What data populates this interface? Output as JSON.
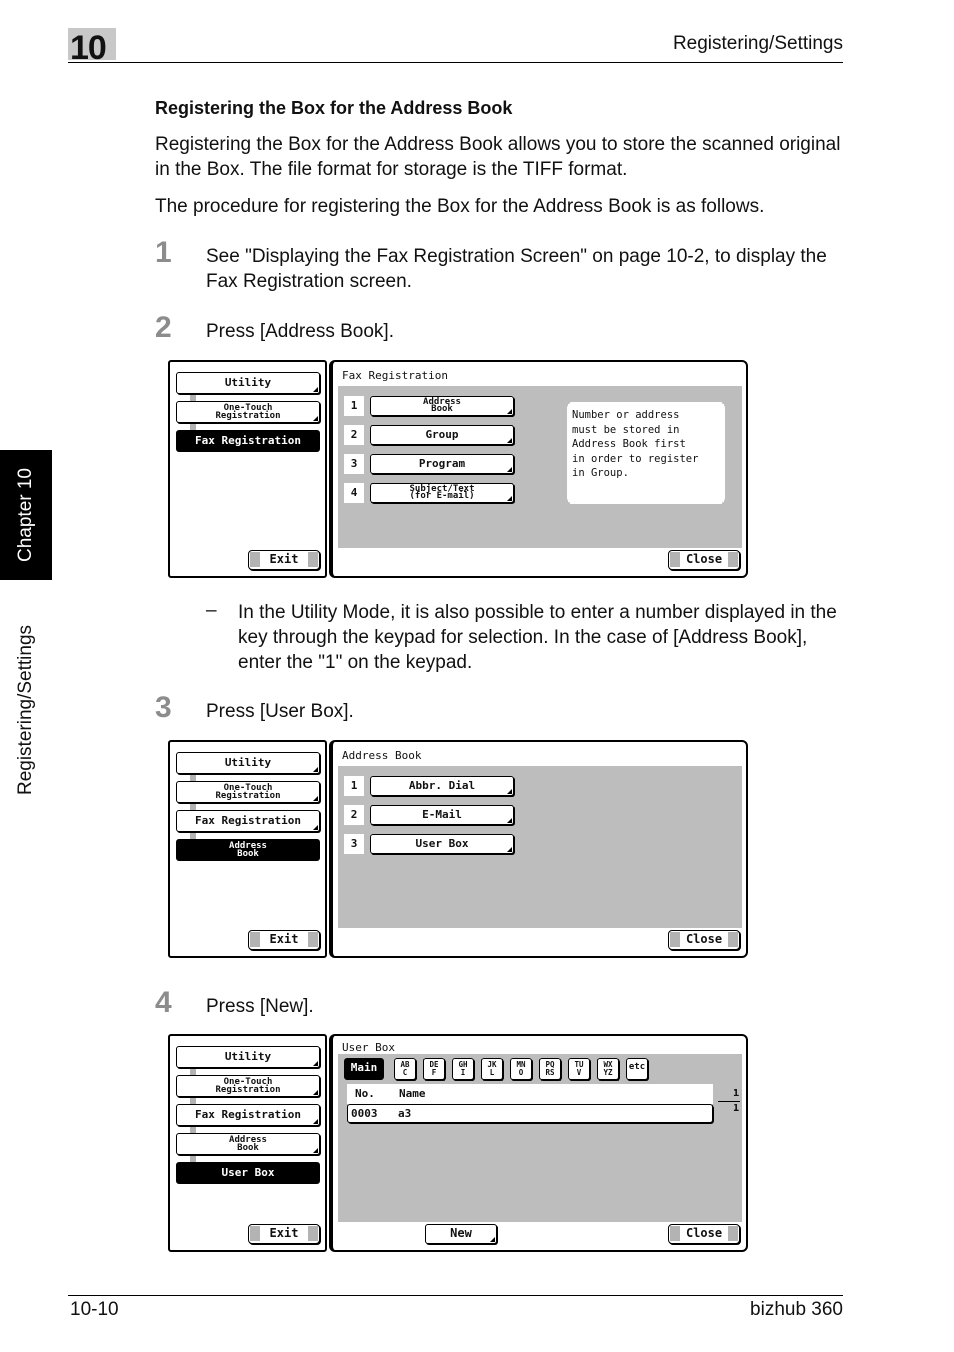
{
  "header": {
    "chapter_number": "10",
    "section_title": "Registering/Settings"
  },
  "side_tabs": {
    "chapter": "Chapter 10",
    "section": "Registering/Settings"
  },
  "content": {
    "heading": "Registering the Box for the Address Book",
    "intro": "Registering the Box for the Address Book allows you to store the scanned original in the Box. The file format for storage is the TIFF format.",
    "procedure_intro": "The procedure for registering the Box for the Address Book is as follows.",
    "steps": [
      {
        "number": "1",
        "text": "See \"Displaying the Fax Registration Screen\" on page 10-2, to display the Fax Registration screen."
      },
      {
        "number": "2",
        "text": "Press [Address Book]."
      },
      {
        "number": "3",
        "text": "Press [User Box]."
      },
      {
        "number": "4",
        "text": "Press [New]."
      }
    ],
    "note": {
      "bullet": "–",
      "text": "In the Utility Mode, it is also possible to enter a number displayed in the key through the keypad for selection. In the case of [Address Book], enter the \"1\" on the keypad."
    }
  },
  "screens": {
    "fax_registration": {
      "left_menu": {
        "utility": "Utility",
        "one_touch_line1": "One-Touch",
        "one_touch_line2": "Registration",
        "fax_registration": "Fax Registration",
        "exit": "Exit"
      },
      "title": "Fax Registration",
      "options": [
        {
          "num": "1",
          "line1": "Address",
          "line2": "Book"
        },
        {
          "num": "2",
          "label": "Group"
        },
        {
          "num": "3",
          "label": "Program"
        },
        {
          "num": "4",
          "line1": "Subject/Text",
          "line2": "(for E-mail)"
        }
      ],
      "message": "Number or address\nmust be stored in\nAddress Book first\nin order to register\nin Group.",
      "close": "Close"
    },
    "address_book": {
      "left_menu": {
        "utility": "Utility",
        "one_touch_line1": "One-Touch",
        "one_touch_line2": "Registration",
        "fax_registration": "Fax Registration",
        "address_book_line1": "Address",
        "address_book_line2": "Book",
        "exit": "Exit"
      },
      "title": "Address Book",
      "options": [
        {
          "num": "1",
          "label": "Abbr. Dial"
        },
        {
          "num": "2",
          "label": "E-Mail"
        },
        {
          "num": "3",
          "label": "User Box"
        }
      ],
      "close": "Close"
    },
    "user_box": {
      "left_menu": {
        "utility": "Utility",
        "one_touch_line1": "One-Touch",
        "one_touch_line2": "Registration",
        "fax_registration": "Fax Registration",
        "address_book_line1": "Address",
        "address_book_line2": "Book",
        "user_box": "User Box",
        "exit": "Exit"
      },
      "title": "User Box",
      "index_tabs": [
        {
          "line1": "Main"
        },
        {
          "line1": "AB",
          "line2": "C"
        },
        {
          "line1": "DE",
          "line2": "F"
        },
        {
          "line1": "GH",
          "line2": "I"
        },
        {
          "line1": "JK",
          "line2": "L"
        },
        {
          "line1": "MN",
          "line2": "O"
        },
        {
          "line1": "PQ",
          "line2": "RS"
        },
        {
          "line1": "TU",
          "line2": "V"
        },
        {
          "line1": "WX",
          "line2": "YZ"
        },
        {
          "line1": "etc"
        }
      ],
      "columns": {
        "no": "No.",
        "name": "Name"
      },
      "rows": [
        {
          "no": "0003",
          "name": "a3"
        }
      ],
      "pager": {
        "current": "1",
        "total": "1"
      },
      "new": "New",
      "close": "Close"
    }
  },
  "footer": {
    "page": "10-10",
    "product": "bizhub 360"
  }
}
